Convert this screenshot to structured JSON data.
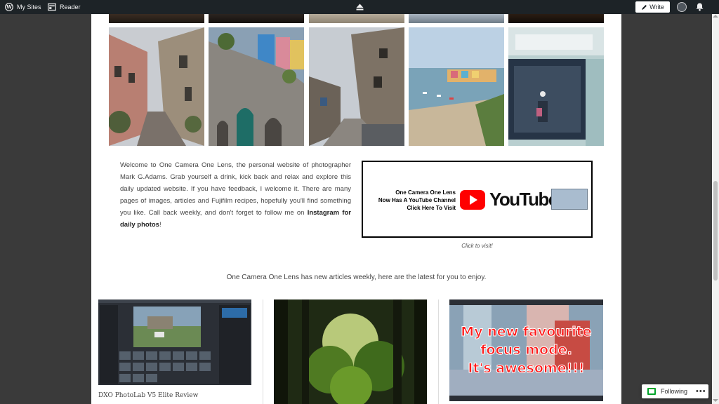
{
  "adminbar": {
    "my_sites": "My Sites",
    "reader": "Reader",
    "write": "Write"
  },
  "intro": {
    "text_before_link": "Welcome to One Camera One Lens, the personal website of photographer Mark G.Adams. Grab yourself a drink, kick back and relax and explore this daily updated website. If you have feedback, I welcome it. There are many pages of images, articles and Fujifilm recipes, hopefully you'll find something you like. Call back weekly, and don't forget to follow me on ",
    "link_text": "Instagram for daily photos",
    "text_after_link": "!"
  },
  "youtube_banner": {
    "line1": "One Camera One Lens",
    "line2": "Now Has A YouTube Channel",
    "line3": "Click Here To Visit",
    "logo_word": "YouTube",
    "caption": "Click to visit!"
  },
  "latest_heading": "One Camera One Lens has new articles weekly, here are the latest for you to enjoy.",
  "articles": [
    {
      "title": "DXO PhotoLab V5 Elite Review"
    },
    {
      "title": ""
    },
    {
      "title": "",
      "image_text": [
        "My new favourite",
        "focus mode.",
        "It's awesome!!!"
      ]
    }
  ],
  "follow_widget": {
    "label": "Following",
    "menu": "•••"
  },
  "colors": {
    "adminbar": "#1d2327",
    "background": "#3a3a3a",
    "youtube_red": "#ff0000",
    "follow_green": "#00a32a"
  }
}
